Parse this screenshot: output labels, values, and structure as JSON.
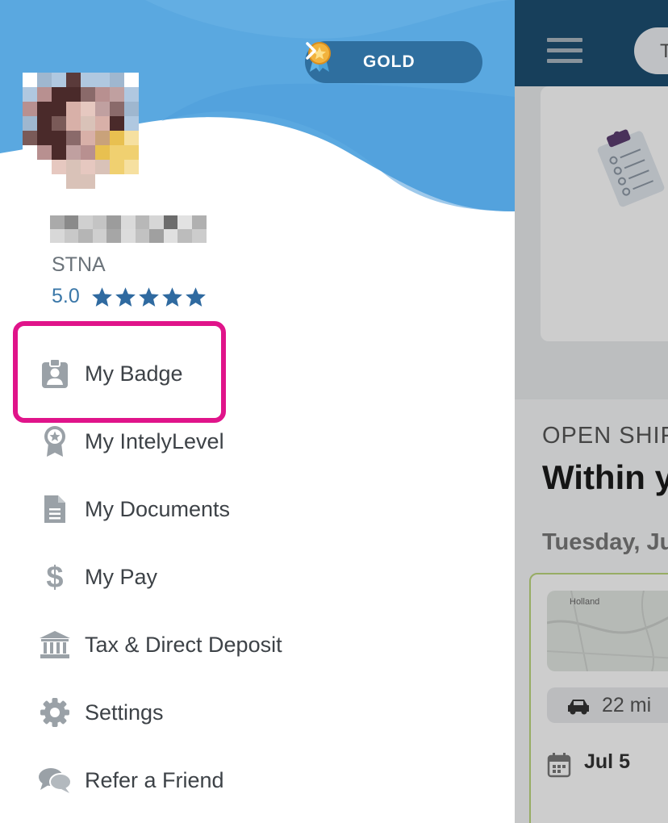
{
  "drawer": {
    "tier": {
      "label": "GOLD",
      "icon": "gold-medal-icon"
    },
    "user": {
      "role": "STNA",
      "rating": "5.0",
      "stars": 5
    },
    "menu": [
      {
        "label": "My Badge",
        "icon": "badge-icon"
      },
      {
        "label": "My IntelyLevel",
        "icon": "ribbon-award-icon"
      },
      {
        "label": "My Documents",
        "icon": "document-icon"
      },
      {
        "label": "My Pay",
        "icon": "dollar-icon"
      },
      {
        "label": "Tax & Direct Deposit",
        "icon": "bank-icon"
      },
      {
        "label": "Settings",
        "icon": "gear-icon"
      },
      {
        "label": "Refer a Friend",
        "icon": "chat-bubbles-icon"
      }
    ],
    "highlighted_item": "My Badge"
  },
  "background_app": {
    "topbar_pill_text": "T",
    "section_heading": "OPEN SHIF",
    "section_title": "Within y",
    "date_heading": "Tuesday, Ju",
    "shift_card": {
      "map_label": "Holland",
      "distance": "22 mi",
      "date": "Jul 5"
    }
  },
  "colors": {
    "header_blue": "#5aa8e0",
    "header_wave_blue": "#4f9ddb",
    "tier_pill": "#2f6f9f",
    "rating_blue": "#3a77a8",
    "star_color": "#2f6aa0",
    "highlight_magenta": "#e0148a",
    "icon_gray": "#9aa1a7",
    "app_topbar": "#1d4d70"
  }
}
